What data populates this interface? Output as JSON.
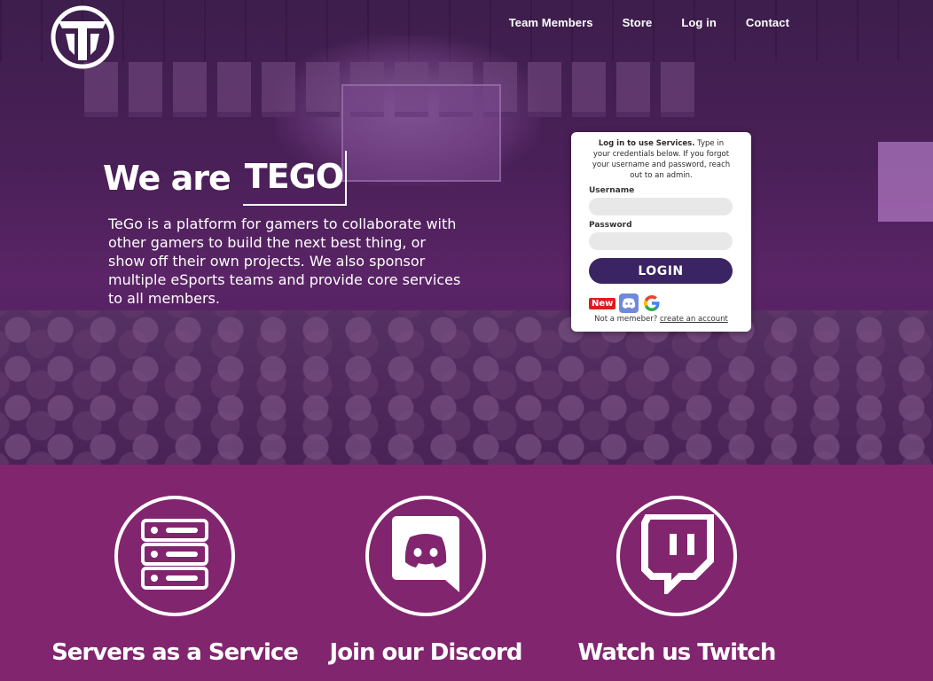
{
  "nav": {
    "logo_icon": "tego-logo-icon",
    "items": [
      {
        "label": "Team Members"
      },
      {
        "label": "Store"
      },
      {
        "label": "Log in"
      },
      {
        "label": "Contact"
      }
    ]
  },
  "hero": {
    "headline_static": "We are",
    "headline_typed": "TEGO",
    "description": "TeGo is a platform for gamers to collaborate with other gamers to build the next best thing, or show off their own projects. We also sponsor multiple eSports teams and provide core services to all members."
  },
  "login": {
    "intro_bold": "Log in to use Services.",
    "intro_rest": " Type in your credentials below. If you forgot your username and password, reach out to an admin.",
    "username_label": "Username",
    "password_label": "Password",
    "username_value": "",
    "password_value": "",
    "button_label": "LOGIN",
    "new_badge": "New",
    "signup_prefix": "Not a memeber?",
    "signup_link": "create an account"
  },
  "features": [
    {
      "icon": "server-stack-icon",
      "title": "Servers as a Service"
    },
    {
      "icon": "discord-icon",
      "title": "Join our Discord"
    },
    {
      "icon": "twitch-icon",
      "title": "Watch us Twitch"
    }
  ],
  "colors": {
    "hero_tint": "#4a2058",
    "features_bg": "#82256f",
    "login_button": "#3b2463",
    "new_badge": "#e01b1b",
    "discord_blurple": "#7289da"
  }
}
